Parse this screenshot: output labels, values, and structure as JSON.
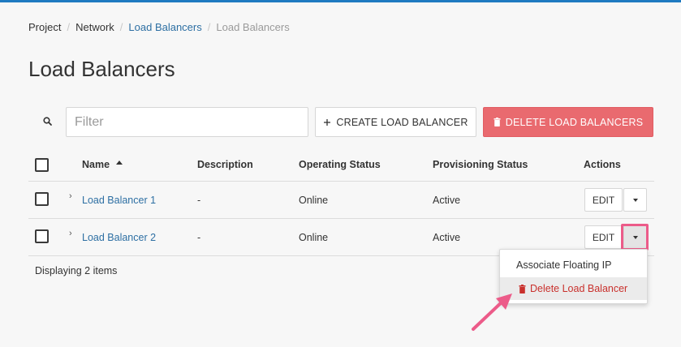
{
  "breadcrumb": {
    "items": [
      "Project",
      "Network",
      "Load Balancers",
      "Load Balancers"
    ],
    "separator": "/"
  },
  "page": {
    "title": "Load Balancers"
  },
  "toolbar": {
    "filter_placeholder": "Filter",
    "create_label": "CREATE LOAD BALANCER",
    "delete_label": "DELETE LOAD BALANCERS",
    "create_icon": "plus-icon",
    "delete_icon": "trash-icon"
  },
  "table": {
    "headers": {
      "name": "Name",
      "description": "Description",
      "operating_status": "Operating Status",
      "provisioning_status": "Provisioning Status",
      "actions": "Actions"
    },
    "sort": {
      "column": "Name",
      "direction": "ascending"
    },
    "rows": [
      {
        "name": "Load Balancer 1",
        "description": "-",
        "operating_status": "Online",
        "provisioning_status": "Active",
        "edit_label": "EDIT"
      },
      {
        "name": "Load Balancer 2",
        "description": "-",
        "operating_status": "Online",
        "provisioning_status": "Active",
        "edit_label": "EDIT"
      }
    ],
    "footer": "Displaying 2 items"
  },
  "dropdown": {
    "items": [
      {
        "label": "Associate Floating IP"
      },
      {
        "label": "Delete Load Balancer",
        "icon": "trash-icon"
      }
    ]
  },
  "colors": {
    "accent_bar": "#1f7ac1",
    "link": "#2d6fa3",
    "danger_button": "#e96a6f",
    "danger_text": "#c9302c",
    "annotation": "#ec5b89"
  }
}
